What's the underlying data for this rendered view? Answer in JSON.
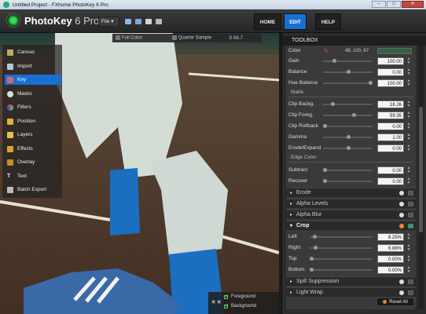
{
  "window": {
    "title": "Untitled Project - FXhome PhotoKey 6 Pro",
    "min": "–",
    "max": "□",
    "close": "✕"
  },
  "app": {
    "name": "PhotoKey",
    "version": "6 Pro",
    "file_menu": "File",
    "file_menu_arrow": "▾"
  },
  "nav": {
    "home": "HOME",
    "edit": "EDIT",
    "help": "HELP"
  },
  "viewer_toolbar": {
    "full_color": "Full Color",
    "quarter_sample": "Quarter Sample",
    "zoom": "66.7"
  },
  "tools": [
    "Canvas",
    "Import",
    "Key",
    "Masks",
    "Filters",
    "Position",
    "Layers",
    "Effects",
    "Overlay",
    "Text",
    "Batch Export"
  ],
  "active_tool": "Key",
  "layers": {
    "foreground": "Foreground",
    "background": "Background"
  },
  "toolbox": {
    "title": "TOOLBOX"
  },
  "color_row": {
    "label": "Color",
    "value": "48, 100, 67",
    "swatch": "#2f6443"
  },
  "params_top": [
    {
      "label": "Gain",
      "value": "100.00"
    },
    {
      "label": "Balance",
      "value": "0.00"
    },
    {
      "label": "Hue Balance",
      "value": "100.00"
    }
  ],
  "matte_title": "Matte",
  "matte": [
    {
      "label": "Clip Backg.",
      "value": "16.26"
    },
    {
      "label": "Clip Foreg.",
      "value": "59.35"
    },
    {
      "label": "Clip Rollback",
      "value": "0.00"
    },
    {
      "label": "Gamma",
      "value": "1.00"
    },
    {
      "label": "Erode/Expand",
      "value": "0.00"
    }
  ],
  "edge_title": "Edge Color",
  "edge": [
    {
      "label": "Subtract",
      "value": "0.00"
    },
    {
      "label": "Recover",
      "value": "0.00"
    }
  ],
  "groups": [
    "Erode",
    "Alpha Levels",
    "Alpha Blur"
  ],
  "crop": {
    "title": "Crop",
    "rows": [
      {
        "label": "Left",
        "value": "6.25%"
      },
      {
        "label": "Right",
        "value": "6.88%"
      },
      {
        "label": "Top",
        "value": "0.00%"
      },
      {
        "label": "Bottom",
        "value": "0.00%"
      }
    ]
  },
  "groups_bottom": [
    "Spill Suppression",
    "Light Wrap"
  ],
  "reset_all": "Reset All"
}
